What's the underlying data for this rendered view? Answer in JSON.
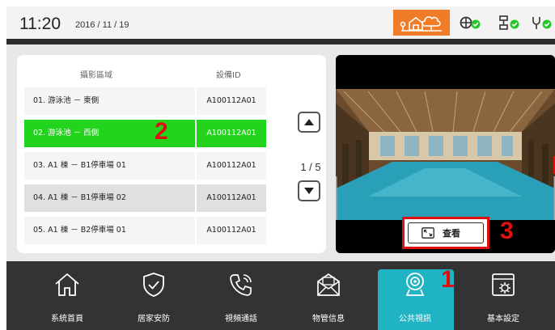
{
  "status_bar": {
    "time": "11:20",
    "date": "2016 / 11 / 19",
    "colors": {
      "home_badge": "#f07c27",
      "ok": "#29c629"
    },
    "icons": [
      "home-status-icon",
      "shield-status-icon",
      "network-status-icon",
      "power-plug-status-icon"
    ]
  },
  "camera_list": {
    "headers": {
      "area": "攝影區域",
      "device_id": "設備ID"
    },
    "rows": [
      {
        "area": "01. 游泳池 － 東側",
        "device_id": "A100112A01"
      },
      {
        "area": "02. 游泳池 － 西側",
        "device_id": "A100112A01",
        "selected": true
      },
      {
        "area": "03. A1 棟 － B1停車場 01",
        "device_id": "A100112A01"
      },
      {
        "area": "04. A1 棟 － B1停車場 02",
        "device_id": "A100112A01"
      },
      {
        "area": "05. A1 棟 － B2停車場 01",
        "device_id": "A100112A01"
      }
    ],
    "pager": "1 / 5",
    "selected_color": "#22d41d"
  },
  "preview": {
    "view_button_label": "查看"
  },
  "annotations": {
    "one": "1",
    "two": "2",
    "three": "3",
    "color": "#e01010"
  },
  "nav": {
    "items": [
      {
        "label": "系統首頁",
        "icon": "home-icon"
      },
      {
        "label": "居家安防",
        "icon": "shield-check-icon"
      },
      {
        "label": "視頻通話",
        "icon": "phone-call-icon"
      },
      {
        "label": "物管信息",
        "icon": "mail-envelope-icon"
      },
      {
        "label": "公共視訊",
        "icon": "webcam-icon",
        "active": true
      },
      {
        "label": "基本設定",
        "icon": "settings-window-icon"
      }
    ],
    "active_color": "#20b3c4"
  }
}
